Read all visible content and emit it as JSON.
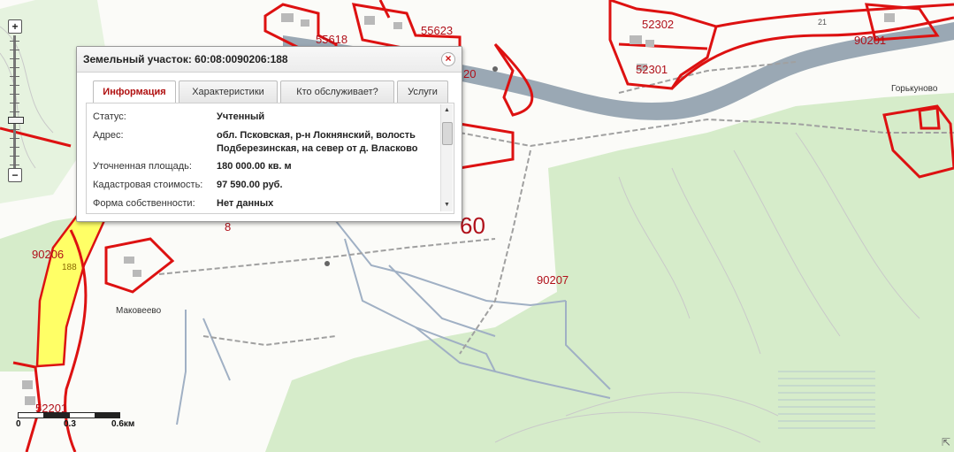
{
  "popup": {
    "title": "Земельный участок: 60:08:0090206:188",
    "tabs": [
      {
        "label": "Информация",
        "active": true
      },
      {
        "label": "Характеристики",
        "active": false
      },
      {
        "label": "Кто обслуживает?",
        "active": false
      },
      {
        "label": "Услуги",
        "active": false
      }
    ],
    "fields": [
      {
        "label": "Статус:",
        "value": "Учтенный"
      },
      {
        "label": "Адрес:",
        "value_lines": [
          "обл. Псковская, р-н Локнянский, волость",
          "Подберезинская, на север от д. Власково"
        ]
      },
      {
        "label": "Уточненная площадь:",
        "value": "180 000.00 кв. м"
      },
      {
        "label": "Кадастровая стоимость:",
        "value": "97 590.00 руб."
      },
      {
        "label": "Форма собственности:",
        "value": "Нет данных"
      }
    ],
    "close_symbol": "×"
  },
  "map": {
    "parcel_labels": {
      "a": "55618",
      "b": "55623",
      "c": "52302",
      "d": "52301",
      "e": "90201",
      "f": "90206",
      "g": "90207",
      "h": "52201",
      "i": "20",
      "j": "60",
      "k": "8",
      "l": "188",
      "m": "21"
    },
    "villages": {
      "gorkunovo": "Горькуново",
      "makoveevo": "Маковеево"
    },
    "colors": {
      "parcel_border": "#dd1111",
      "selected_fill": "#ffff66",
      "forest": "#dcefd3",
      "river": "#9aaab8"
    }
  },
  "scale": {
    "ticks": [
      "0",
      "0.3",
      "0.6км"
    ]
  },
  "zoom": {
    "plus": "+",
    "minus": "−",
    "level_fraction": 0.62
  },
  "icons": {
    "close": "close-icon",
    "resize": "resize-handle-icon",
    "zoom_in": "zoom-in-icon",
    "zoom_out": "zoom-out-icon"
  }
}
